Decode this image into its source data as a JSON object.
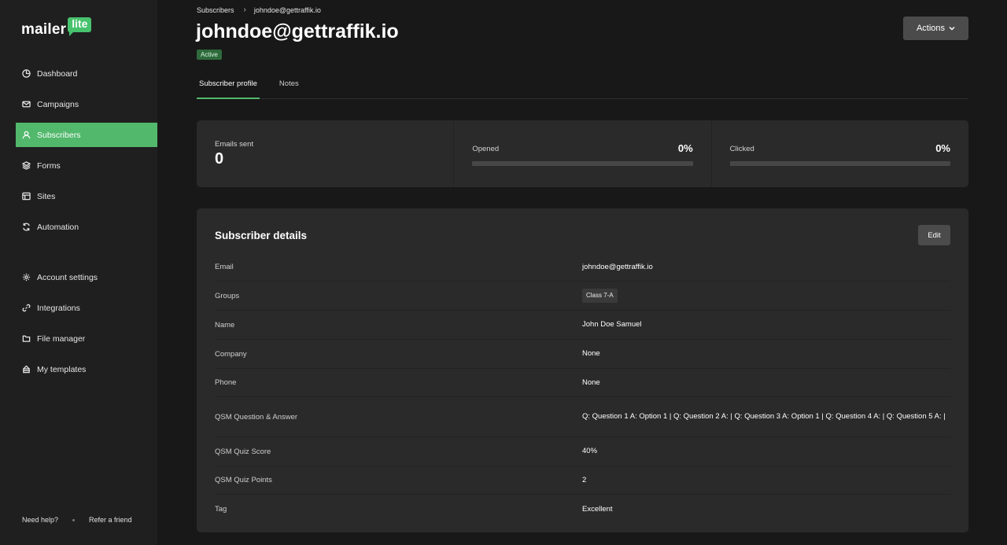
{
  "app": {
    "logo_word": "mailer",
    "logo_badge": "lite"
  },
  "sidebar": {
    "items": [
      {
        "label": "Dashboard",
        "icon": "clock-pie-icon"
      },
      {
        "label": "Campaigns",
        "icon": "envelope-icon"
      },
      {
        "label": "Subscribers",
        "icon": "user-icon",
        "active": true
      },
      {
        "label": "Forms",
        "icon": "layers-icon"
      },
      {
        "label": "Sites",
        "icon": "browser-icon"
      },
      {
        "label": "Automation",
        "icon": "refresh-icon"
      },
      {
        "label": "Account settings",
        "icon": "gear-icon"
      },
      {
        "label": "Integrations",
        "icon": "link-icon"
      },
      {
        "label": "File manager",
        "icon": "folder-icon"
      },
      {
        "label": "My templates",
        "icon": "template-icon"
      }
    ],
    "footer": {
      "help": "Need help?",
      "refer": "Refer a friend"
    }
  },
  "header": {
    "breadcrumb_root": "Subscribers",
    "breadcrumb_current": "johndoe@gettraffik.io",
    "title": "johndoe@gettraffik.io",
    "status": "Active",
    "actions_label": "Actions"
  },
  "tabs": [
    {
      "label": "Subscriber profile",
      "active": true
    },
    {
      "label": "Notes",
      "active": false
    }
  ],
  "stats": {
    "emails_sent_label": "Emails sent",
    "emails_sent_value": "0",
    "opened_label": "Opened",
    "opened_pct": "0%",
    "opened_fill": 0,
    "clicked_label": "Clicked",
    "clicked_pct": "0%",
    "clicked_fill": 0
  },
  "details": {
    "title": "Subscriber details",
    "edit_label": "Edit",
    "rows": [
      {
        "label": "Email",
        "value": "johndoe@gettraffik.io"
      },
      {
        "label": "Groups",
        "value": "Class 7-A"
      },
      {
        "label": "Name",
        "value": "John Doe Samuel"
      },
      {
        "label": "Company",
        "value": "None"
      },
      {
        "label": "Phone",
        "value": "None"
      },
      {
        "label": "QSM Question & Answer",
        "value": "Q: Question 1 A: Option 1 | Q: Question 2 A: | Q: Question 3 A: Option 1 | Q: Question 4 A: | Q: Question 5 A: |"
      },
      {
        "label": "QSM Quiz Score",
        "value": "40%"
      },
      {
        "label": "QSM Quiz Points",
        "value": "2"
      },
      {
        "label": "Tag",
        "value": "Excellent"
      }
    ]
  },
  "colors": {
    "accent": "#52b86c",
    "background": "#181818",
    "sidebar": "#1f1f1f",
    "card": "#2a2a2a"
  }
}
